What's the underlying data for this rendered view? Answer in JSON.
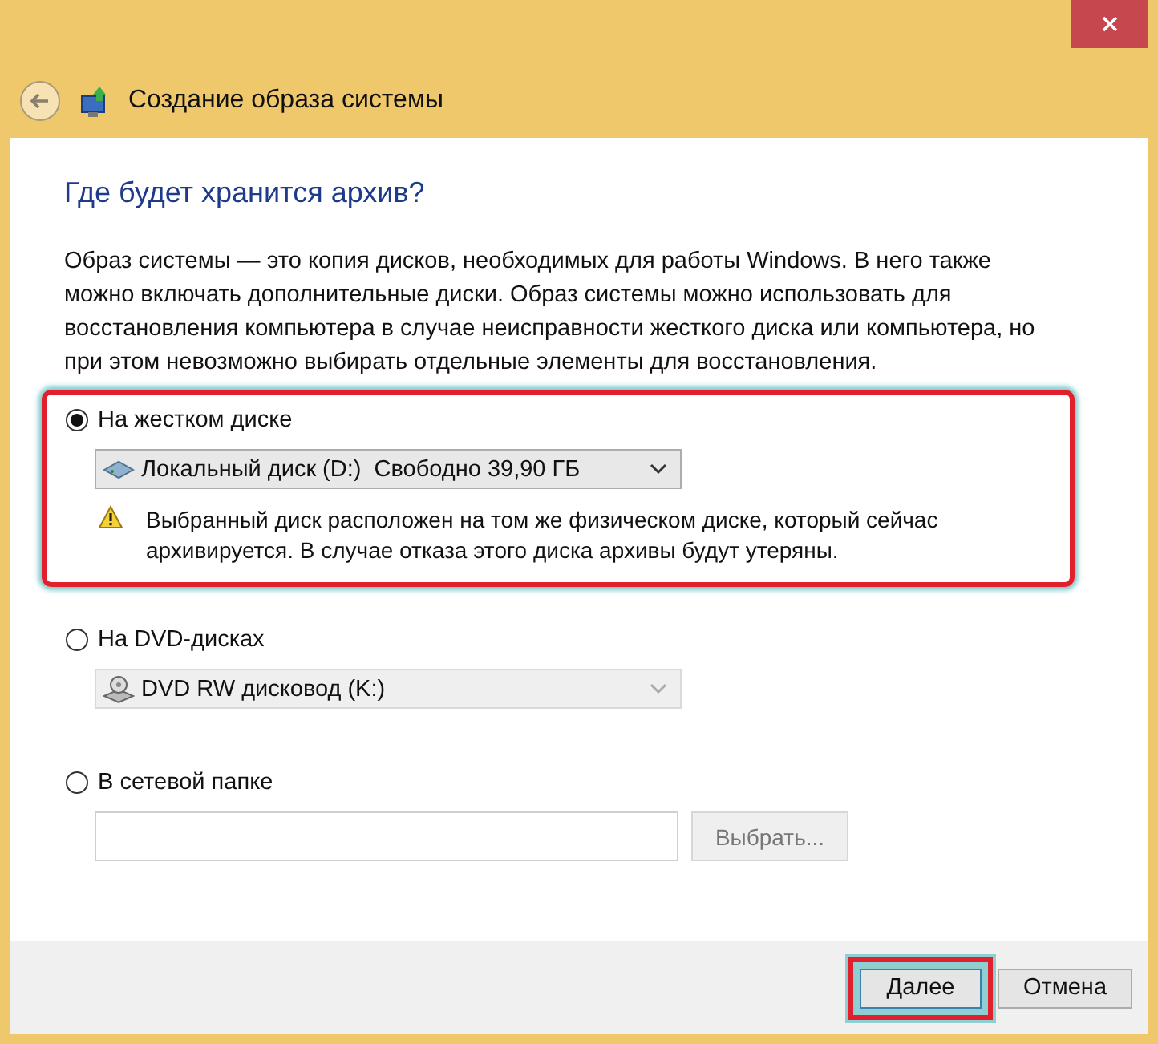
{
  "window": {
    "title": "Создание образа системы"
  },
  "heading": "Где будет хранится архив?",
  "description": "Образ системы — это копия дисков, необходимых для работы Windows. В него также можно включать дополнительные диски. Образ системы можно использовать для восстановления компьютера в случае неисправности жесткого диска или компьютера, но при этом невозможно выбирать отдельные элементы для восстановления.",
  "options": [
    {
      "kind": "drive",
      "label": "На жестком диске",
      "selected": true,
      "highlighted": true,
      "disabled": false,
      "value": "Локальный диск (D:)  Свободно 39,90 ГБ",
      "warning": "Выбранный диск расположен на том же физическом диске, который сейчас архивируется. В случае отказа этого диска архивы будут утеряны."
    },
    {
      "kind": "dvd",
      "label": "На DVD-дисках",
      "selected": false,
      "disabled": true,
      "value": "DVD RW дисковод (K:)"
    },
    {
      "kind": "network",
      "label": "В сетевой папке",
      "selected": false,
      "disabled": true,
      "button": "Выбрать..."
    }
  ],
  "buttons": [
    {
      "label": "Далее",
      "highlighted": true,
      "default": true
    },
    {
      "label": "Отмена",
      "highlighted": false,
      "default": false
    }
  ]
}
